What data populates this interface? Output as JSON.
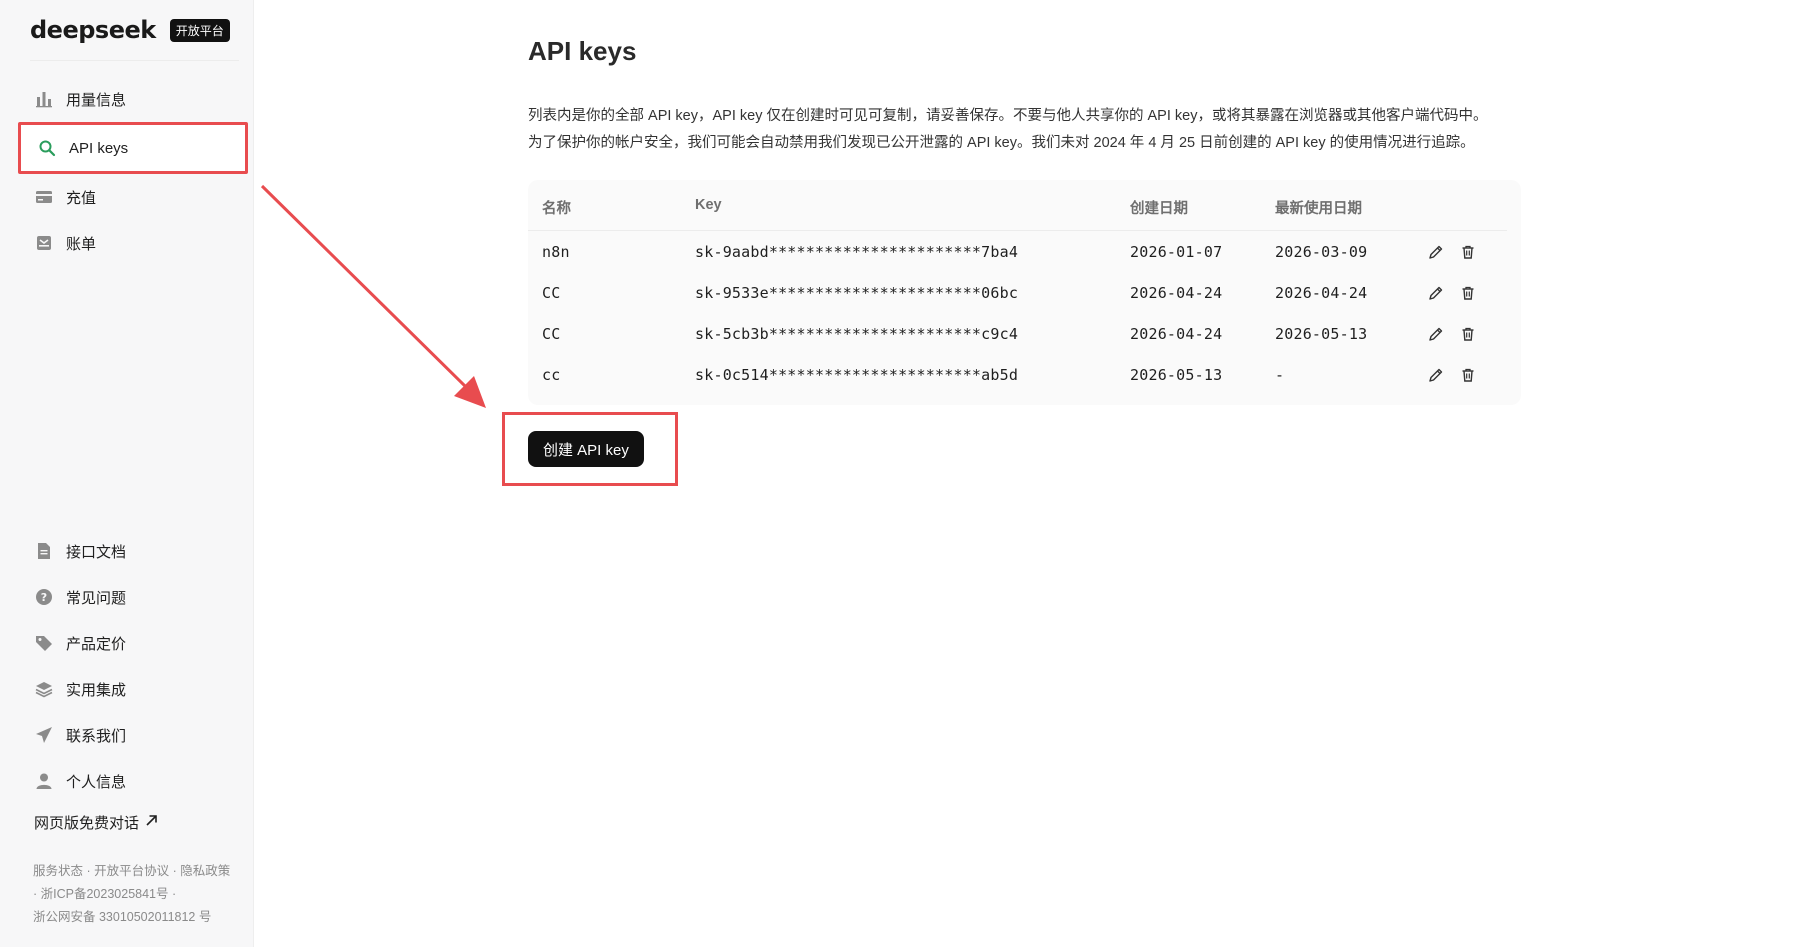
{
  "brand": {
    "logo_text": "deepseek",
    "badge": "开放平台"
  },
  "sidebar": {
    "top_items": [
      {
        "label": "用量信息",
        "icon": "bar-chart-icon"
      },
      {
        "label": "API keys",
        "icon": "search-icon"
      },
      {
        "label": "充值",
        "icon": "card-icon"
      },
      {
        "label": "账单",
        "icon": "bill-icon"
      }
    ],
    "bottom_items": [
      {
        "label": "接口文档",
        "icon": "document-icon"
      },
      {
        "label": "常见问题",
        "icon": "question-icon"
      },
      {
        "label": "产品定价",
        "icon": "tag-icon"
      },
      {
        "label": "实用集成",
        "icon": "layers-icon"
      },
      {
        "label": "联系我们",
        "icon": "send-icon"
      },
      {
        "label": "个人信息",
        "icon": "user-icon"
      }
    ],
    "web_chat": "网页版免费对话",
    "footer": {
      "service_status": "服务状态",
      "agreement": "开放平台协议",
      "privacy": "隐私政策",
      "icp": "浙ICP备2023025841号",
      "police": "浙公网安备 33010502011812 号",
      "sep": " · "
    }
  },
  "main": {
    "title": "API keys",
    "desc_line1": "列表内是你的全部 API key，API key 仅在创建时可见可复制，请妥善保存。不要与他人共享你的 API key，或将其暴露在浏览器或其他客户端代码中。",
    "desc_line2": "为了保护你的帐户安全，我们可能会自动禁用我们发现已公开泄露的 API key。我们未对 2024 年 4 月 25 日前创建的 API key 的使用情况进行追踪。",
    "table": {
      "headers": {
        "name": "名称",
        "key": "Key",
        "created": "创建日期",
        "last_used": "最新使用日期"
      },
      "rows": [
        {
          "name": "n8n",
          "key": "sk-9aabd***********************7ba4",
          "created": "2026-01-07",
          "last_used": "2026-03-09"
        },
        {
          "name": "CC",
          "key": "sk-9533e***********************06bc",
          "created": "2026-04-24",
          "last_used": "2026-04-24"
        },
        {
          "name": "CC",
          "key": "sk-5cb3b***********************c9c4",
          "created": "2026-04-24",
          "last_used": "2026-05-13"
        },
        {
          "name": "cc",
          "key": "sk-0c514***********************ab5d",
          "created": "2026-05-13",
          "last_used": "-"
        }
      ]
    },
    "create_button": "创建 API key"
  },
  "colors": {
    "accent_red": "#e84c4f",
    "button_black": "#111111",
    "active_green": "#2a9d5c"
  }
}
